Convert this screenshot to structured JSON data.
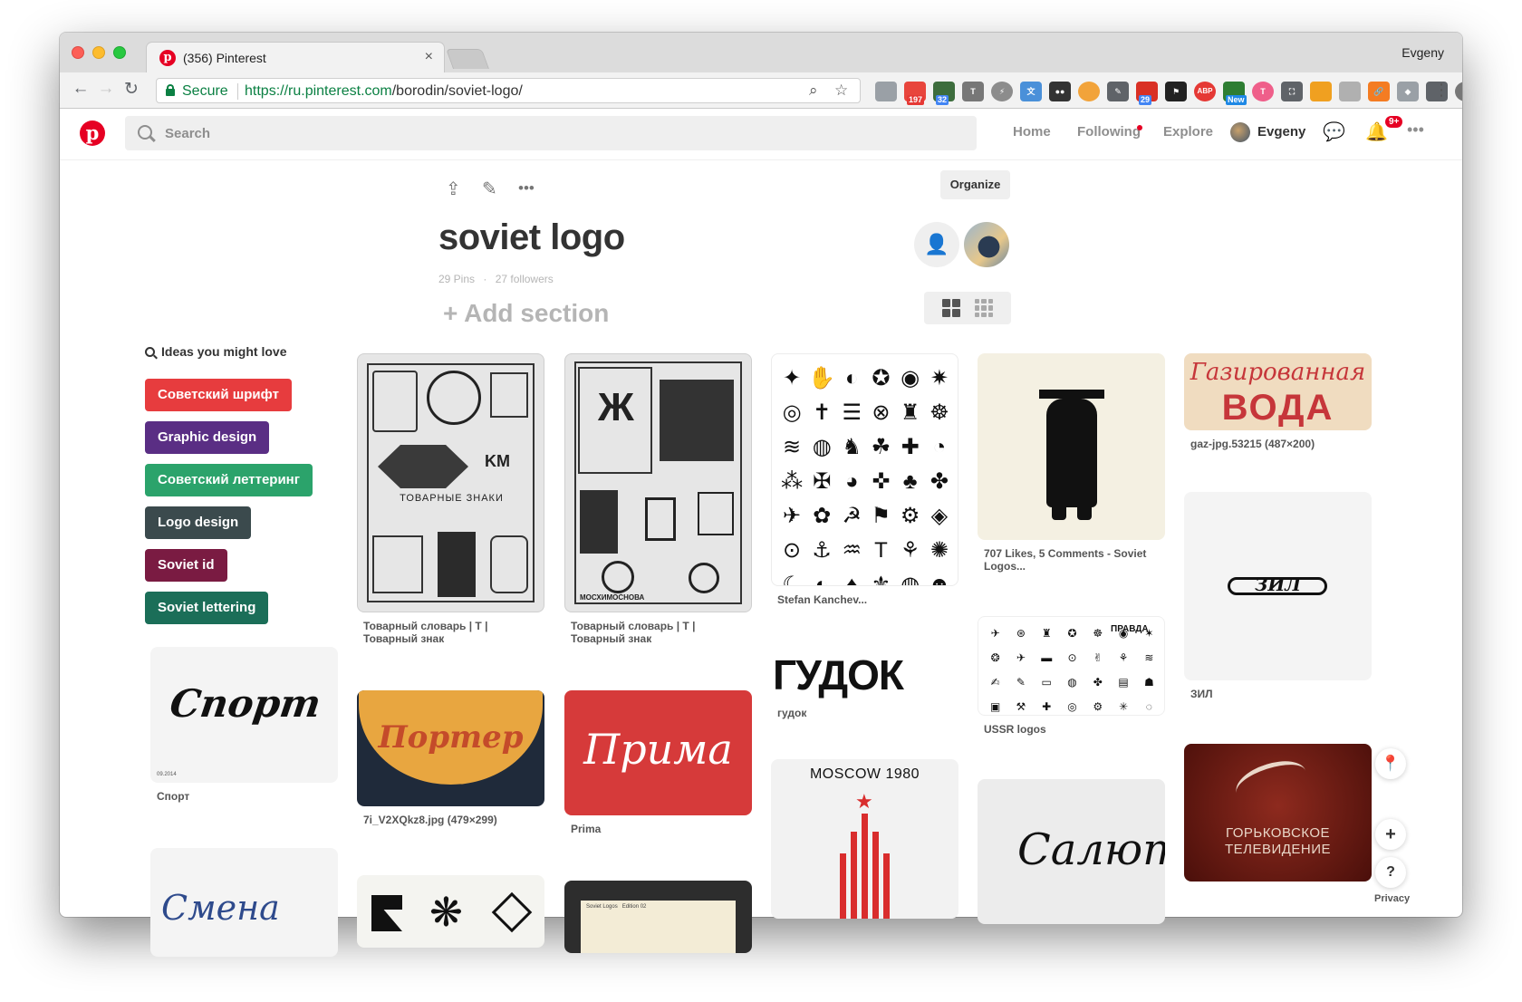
{
  "browser": {
    "tab_title": "(356) Pinterest",
    "profile_name": "Evgeny",
    "secure_label": "Secure",
    "url_origin": "https://ru.pinterest.com",
    "url_path": "/borodin/soviet-logo/",
    "extension_badges": [
      "197",
      "32",
      "29",
      "ABP",
      "New"
    ]
  },
  "header": {
    "search_placeholder": "Search",
    "nav": [
      "Home",
      "Following",
      "Explore"
    ],
    "user_name": "Evgeny",
    "notifications_badge": "9+"
  },
  "board": {
    "organize_label": "Organize",
    "title": "soviet logo",
    "pins_count": "29 Pins",
    "followers_count": "27 followers",
    "add_section_label": "Add section"
  },
  "ideas": {
    "heading": "Ideas you might love",
    "chips": [
      {
        "label": "Советский шрифт",
        "color": "#e73c3e"
      },
      {
        "label": "Graphic design",
        "color": "#5a2e84"
      },
      {
        "label": "Советский леттеринг",
        "color": "#2ba36b"
      },
      {
        "label": "Logo design",
        "color": "#3b4a4d"
      },
      {
        "label": "Soviet id",
        "color": "#7a1b42"
      },
      {
        "label": "Soviet lettering",
        "color": "#1b6e58"
      }
    ]
  },
  "pins": {
    "sport": {
      "art": "Спорт",
      "caption": "Спорт",
      "small": "09.2014"
    },
    "smena": {
      "art": "Смена"
    },
    "tovar1": {
      "caption": "Товарный словарь | Т | Товарный знак",
      "art_label": "ТОВАРНЫЕ ЗНАКИ"
    },
    "tovar2": {
      "caption": "Товарный словарь | Т | Товарный знак",
      "art_label": "МОСХИМОСНОВА"
    },
    "porter": {
      "caption": "7i_V2XQkz8.jpg (479×299)",
      "art": "Портер"
    },
    "prima": {
      "caption": "Prima",
      "art": "Прима"
    },
    "stefan": {
      "caption": "Stefan Kanchev..."
    },
    "gudok": {
      "caption": "гудок",
      "art": "ГУДОК"
    },
    "moscow": {
      "art": "MOSCOW 1980"
    },
    "likes": {
      "caption": "707 Likes, 5 Comments - Soviet Logos..."
    },
    "ussr": {
      "caption": "USSR logos",
      "art": "ПРАВДА"
    },
    "salut": {
      "art": "Салют"
    },
    "gaz": {
      "caption": "gaz-jpg.53215 (487×200)",
      "art_top": "Газированная",
      "art_bottom": "ВОДА"
    },
    "zil": {
      "caption": "ЗИЛ",
      "art": "ЗИЛ"
    },
    "gorky": {
      "art": "ГОРЬКОВСКОЕ ТЕЛЕВИДЕНИЕ"
    },
    "edition": {
      "art": "Soviet Logos   Edition 02"
    }
  },
  "footer": {
    "privacy": "Privacy",
    "help": "?"
  }
}
